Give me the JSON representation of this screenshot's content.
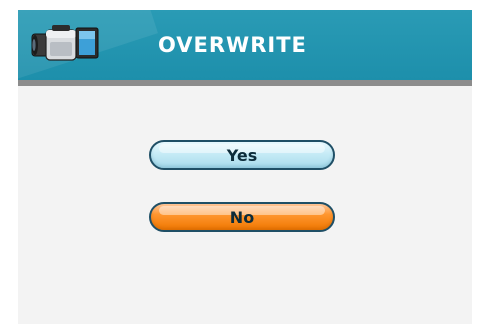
{
  "header": {
    "title": "OVERWRITE",
    "icon": "video-camera-icon"
  },
  "buttons": {
    "yes_label": "Yes",
    "no_label": "No"
  },
  "colors": {
    "header_bg": "#1d8fab",
    "separator": "#8c8c8c",
    "body_bg": "#f3f3f3",
    "yes_button": "#c6ebf6",
    "no_button": "#ff8a1a",
    "button_border": "#1f4f66"
  }
}
